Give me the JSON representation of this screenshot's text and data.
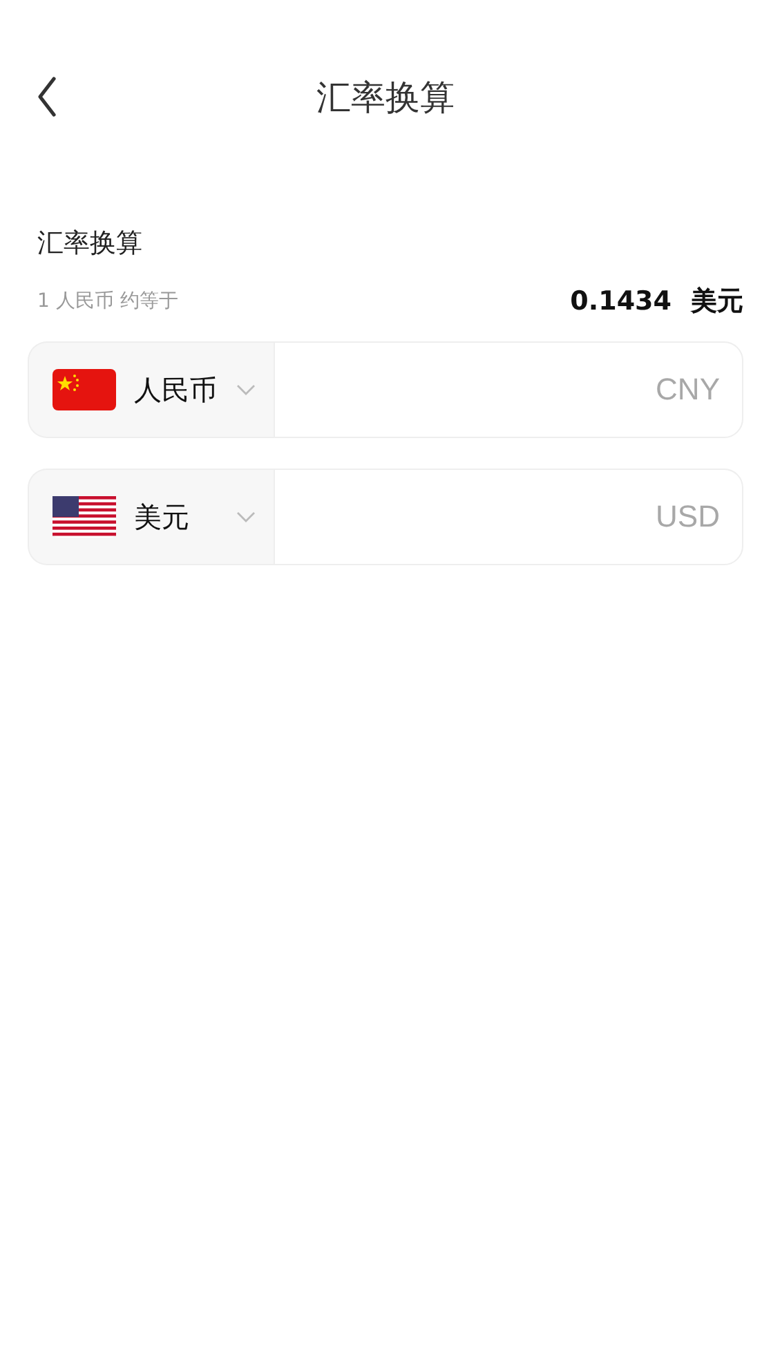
{
  "header": {
    "title": "汇率换算"
  },
  "section": {
    "title": "汇率换算",
    "rate_label": "1 人民币 约等于",
    "rate_value": "0.1434",
    "rate_unit": "美元"
  },
  "currencies": [
    {
      "kind": "cn",
      "name": "人民币",
      "placeholder": "CNY"
    },
    {
      "kind": "us",
      "name": "美元",
      "placeholder": "USD"
    }
  ]
}
